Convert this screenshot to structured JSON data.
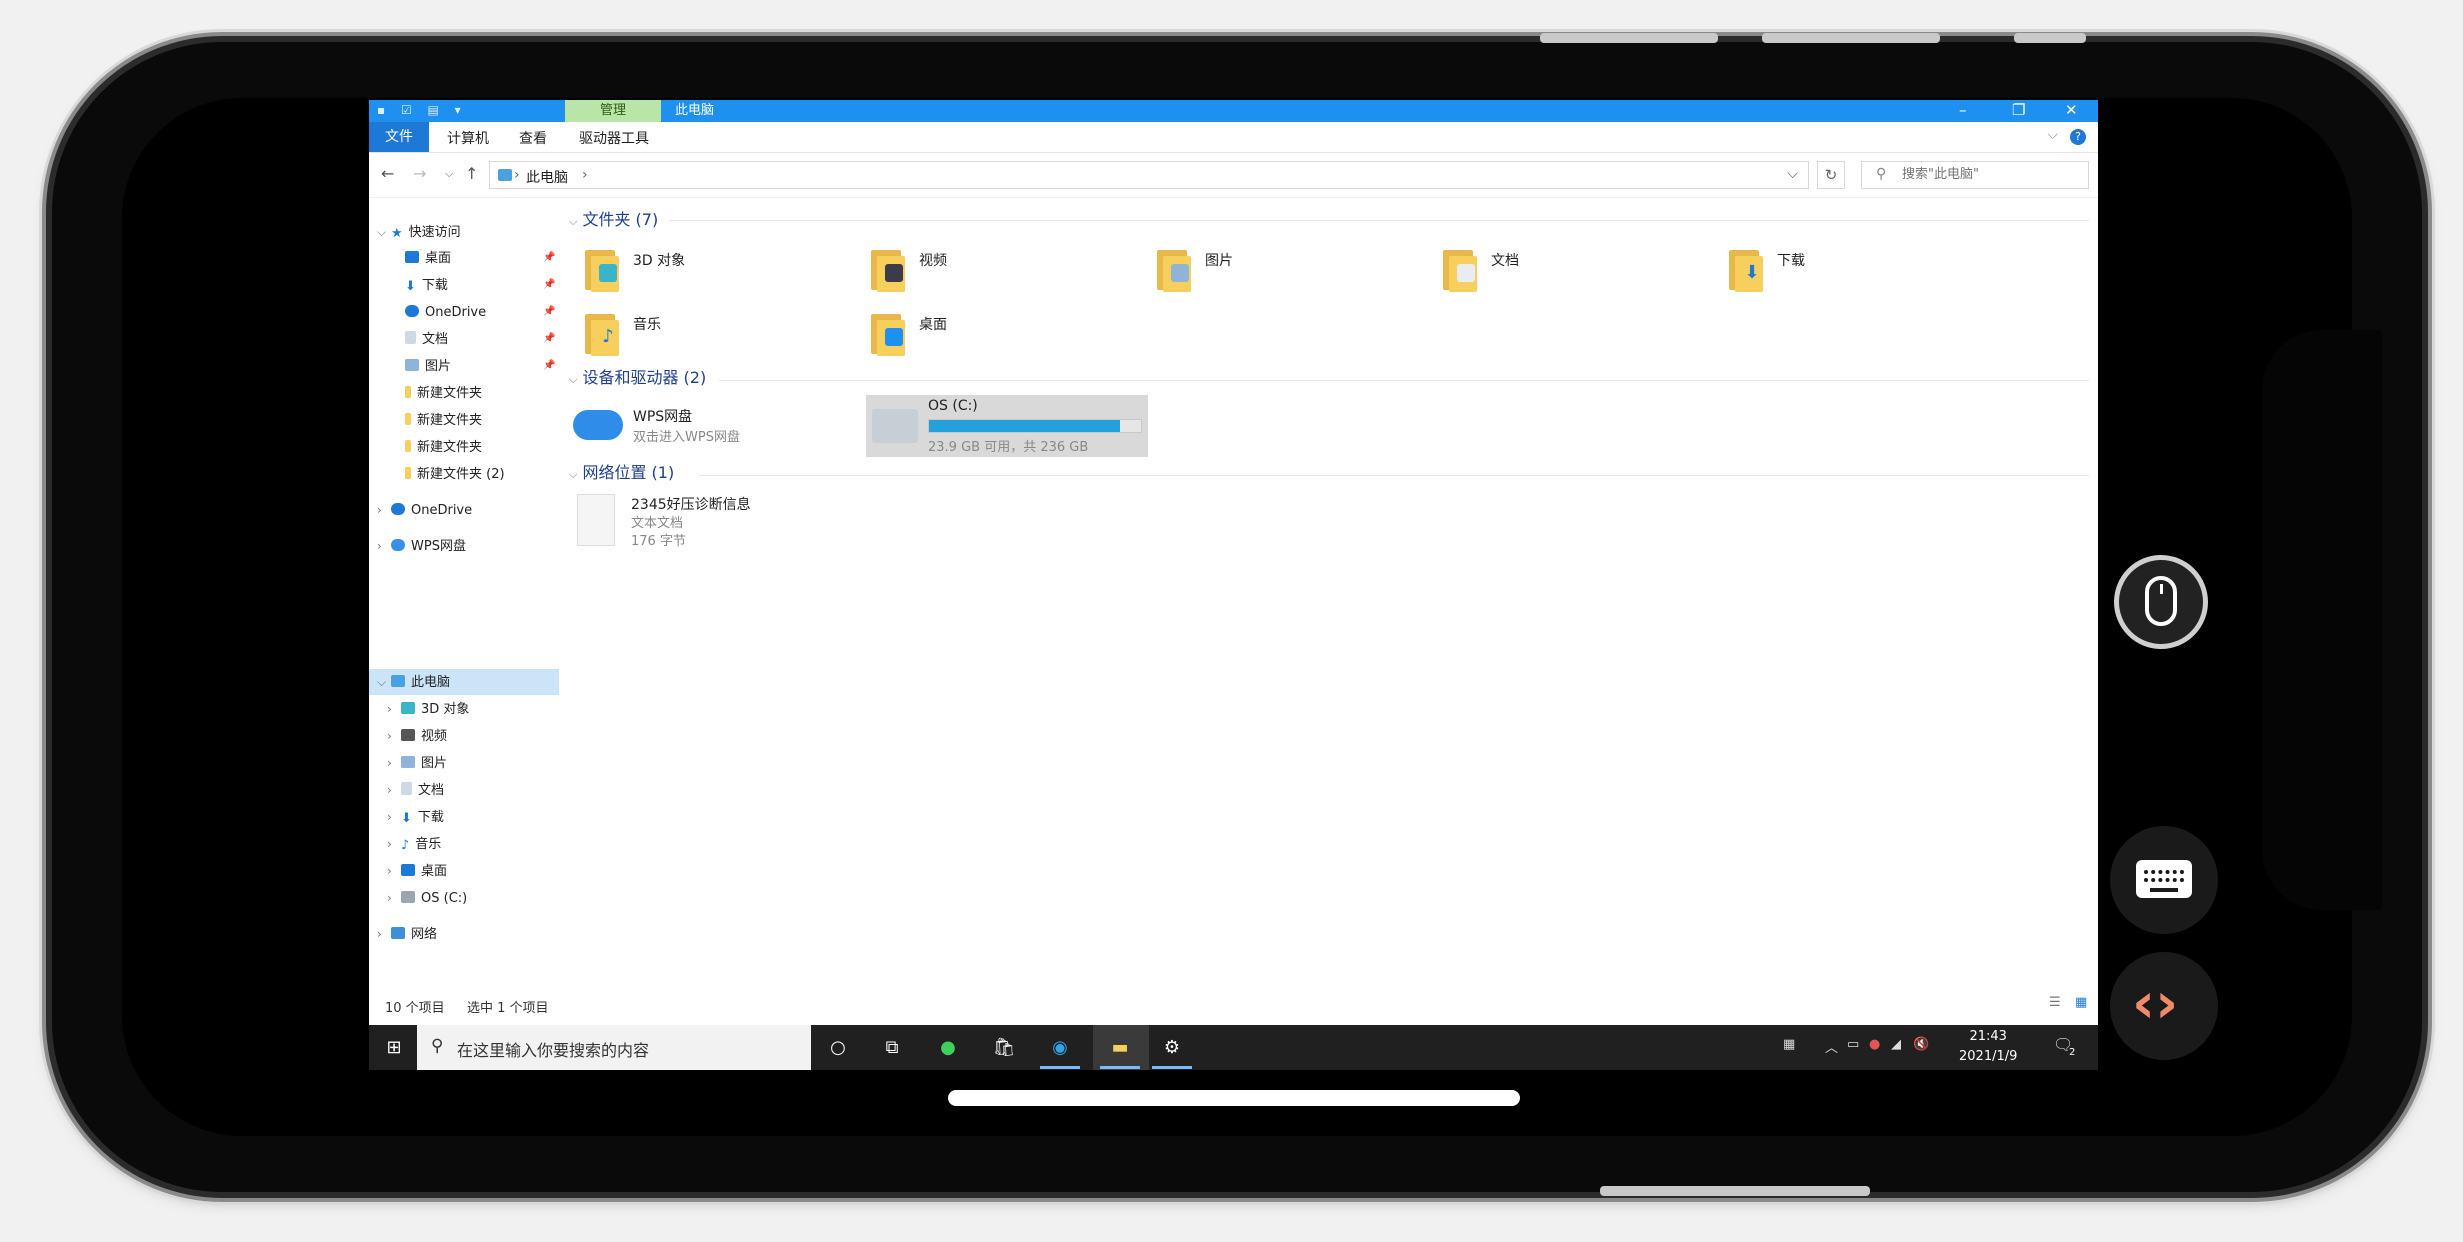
{
  "titlebar": {
    "manage_tab": "管理",
    "title": "此电脑",
    "minimize": "–",
    "maximize": "❐",
    "close": "✕"
  },
  "ribbon": {
    "file": "文件",
    "tabs": [
      "计算机",
      "查看",
      "驱动器工具"
    ]
  },
  "address": {
    "path": "此电脑",
    "search_placeholder": "搜索\"此电脑\""
  },
  "navpane": {
    "quick_access": "快速访问",
    "quick_items": [
      "桌面",
      "下载",
      "OneDrive",
      "文档",
      "图片",
      "新建文件夹",
      "新建文件夹",
      "新建文件夹",
      "新建文件夹 (2)"
    ],
    "onedrive": "OneDrive",
    "wps": "WPS网盘",
    "this_pc": "此电脑",
    "pc_items": [
      "3D 对象",
      "视频",
      "图片",
      "文档",
      "下载",
      "音乐",
      "桌面",
      "OS (C:)"
    ],
    "network": "网络"
  },
  "content": {
    "folders_header": "文件夹 (7)",
    "folders": [
      "3D 对象",
      "视频",
      "图片",
      "文档",
      "下载",
      "音乐",
      "桌面"
    ],
    "devices_header": "设备和驱动器 (2)",
    "wps": {
      "name": "WPS网盘",
      "desc": "双击进入WPS网盘"
    },
    "drive": {
      "name": "OS (C:)",
      "info": "23.9 GB 可用，共 236 GB",
      "used_fraction": 0.9
    },
    "network_header": "网络位置 (1)",
    "netfile": {
      "name": "2345好压诊断信息",
      "type": "文本文档",
      "size": "176 字节"
    }
  },
  "status": {
    "count": "10 个项目",
    "selected": "选中 1 个项目"
  },
  "taskbar": {
    "search_placeholder": "在这里输入你要搜索的内容",
    "time": "21:43",
    "date": "2021/1/9",
    "notif_count": "2"
  },
  "colors": {
    "accent": "#1e90ef",
    "manage_tab": "#b9e6a8",
    "selection": "#cce4f7",
    "drive_fill": "#26a0da",
    "code_button": "#f08a6a"
  }
}
